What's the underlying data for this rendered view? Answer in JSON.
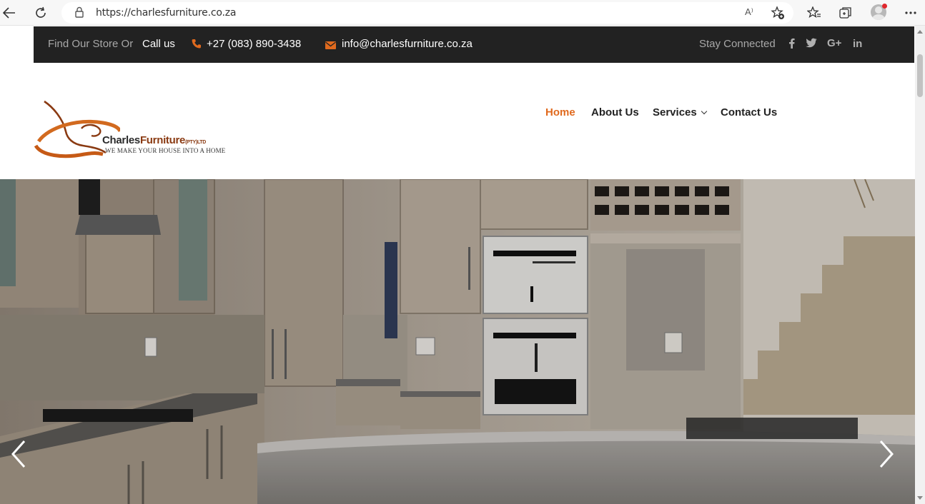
{
  "browser": {
    "url": "https://charlesfurniture.co.za",
    "read_aloud": "A⁾"
  },
  "topbar": {
    "find_store": "Find Our Store Or",
    "call_label": "Call us",
    "phone": "+27 (083) 890-3438",
    "email": "info@charlesfurniture.co.za",
    "stay_connected": "Stay Connected",
    "social": [
      "f",
      "twitter",
      "G+",
      "in"
    ]
  },
  "logo": {
    "brand_a": "Charles",
    "brand_b": "Furniture",
    "pty": "(PTY)LTD",
    "tagline": "WE MAKE YOUR HOUSE INTO A HOME"
  },
  "nav": {
    "home": "Home",
    "about": "About Us",
    "services": "Services",
    "contact": "Contact Us"
  },
  "colors": {
    "accent": "#e06a1e",
    "topbar_bg": "#222222",
    "brand_brown": "#8a3a12"
  },
  "icons": [
    "back-icon",
    "refresh-icon",
    "lock-icon",
    "read-aloud-icon",
    "add-favorite-icon",
    "favorites-icon",
    "collections-icon",
    "avatar",
    "more-icon",
    "phone-icon",
    "mail-icon",
    "facebook-icon",
    "twitter-icon",
    "google-plus-icon",
    "linkedin-icon",
    "chevron-left-icon",
    "chevron-right-icon"
  ]
}
